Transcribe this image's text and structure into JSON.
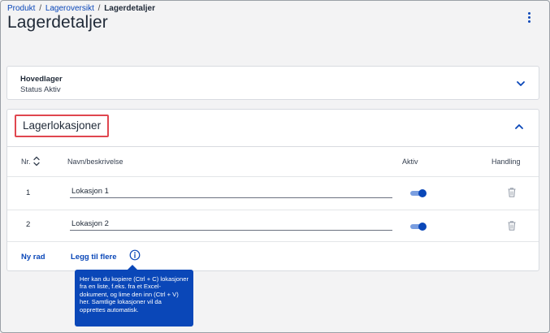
{
  "breadcrumb": {
    "items": [
      "Produkt",
      "Lageroversikt"
    ],
    "separator": "/",
    "current": "Lagerdetaljer"
  },
  "header": {
    "title": "Lagerdetaljer",
    "menu_icon": "more-vertical-icon"
  },
  "main_warehouse": {
    "name": "Hovedlager",
    "status": "Status Aktiv",
    "expanded": false
  },
  "locations": {
    "title": "Lagerlokasjoner",
    "expanded": true,
    "columns": {
      "nr": "Nr.",
      "name": "Navn/beskrivelse",
      "active": "Aktiv",
      "action": "Handling"
    },
    "rows": [
      {
        "nr": "1",
        "name": "Lokasjon 1",
        "active": true
      },
      {
        "nr": "2",
        "name": "Lokasjon 2",
        "active": true
      }
    ],
    "new_row_label": "Ny rad",
    "add_more_label": "Legg til flere"
  },
  "tooltip": {
    "text": "Her kan du kopiere (Ctrl + C) lokasjoner fra en liste, f.eks. fra et Excel-dokument, og lime den inn (Ctrl + V) her. Samtlige lokasjoner vil da opprettes automatisk."
  },
  "colors": {
    "accent": "#0a47b8",
    "highlight_border": "#e0464f",
    "toggle_track": "#7a9ee0",
    "background": "#f3f3f4"
  }
}
